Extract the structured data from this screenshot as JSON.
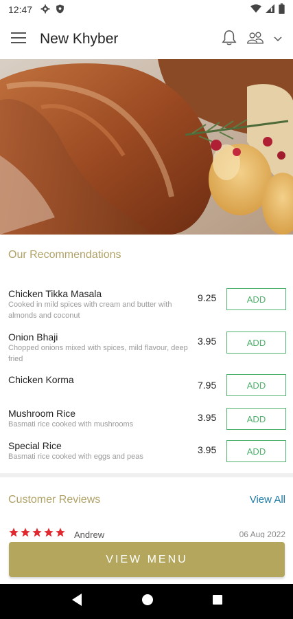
{
  "status_bar": {
    "time": "12:47"
  },
  "app_bar": {
    "title": "New Khyber"
  },
  "recommendations": {
    "title": "Our Recommendations",
    "items": [
      {
        "name": "Chicken Tikka Masala",
        "description": "Cooked in mild spices with cream and butter with almonds and coconut",
        "price": "9.25",
        "button": "ADD"
      },
      {
        "name": "Onion Bhaji",
        "description": "Chopped onions mixed with spices, mild flavour, deep fried",
        "price": "3.95",
        "button": "ADD"
      },
      {
        "name": "Chicken Korma",
        "description": "",
        "price": "7.95",
        "button": "ADD"
      },
      {
        "name": "Mushroom Rice",
        "description": "Basmati rice cooked with mushrooms",
        "price": "3.95",
        "button": "ADD"
      },
      {
        "name": "Special Rice",
        "description": "Basmati rice cooked with eggs and peas",
        "price": "3.95",
        "button": "ADD"
      }
    ]
  },
  "reviews": {
    "title": "Customer Reviews",
    "view_all": "View All",
    "preview": {
      "author": "Andrew",
      "date": "06 Aug 2022",
      "rating": 5
    }
  },
  "cta": {
    "label": "VIEW MENU"
  },
  "colors": {
    "accent_gold": "#b4a65c",
    "add_green": "#4caf6a",
    "link_blue": "#1c7aa8",
    "star_red": "#e0282e"
  },
  "icons": [
    "menu-icon",
    "bell-icon",
    "users-icon",
    "chevron-down-icon",
    "settings-icon",
    "shield-icon",
    "wifi-icon",
    "signal-icon",
    "battery-icon",
    "back-icon",
    "home-icon",
    "recents-icon"
  ]
}
